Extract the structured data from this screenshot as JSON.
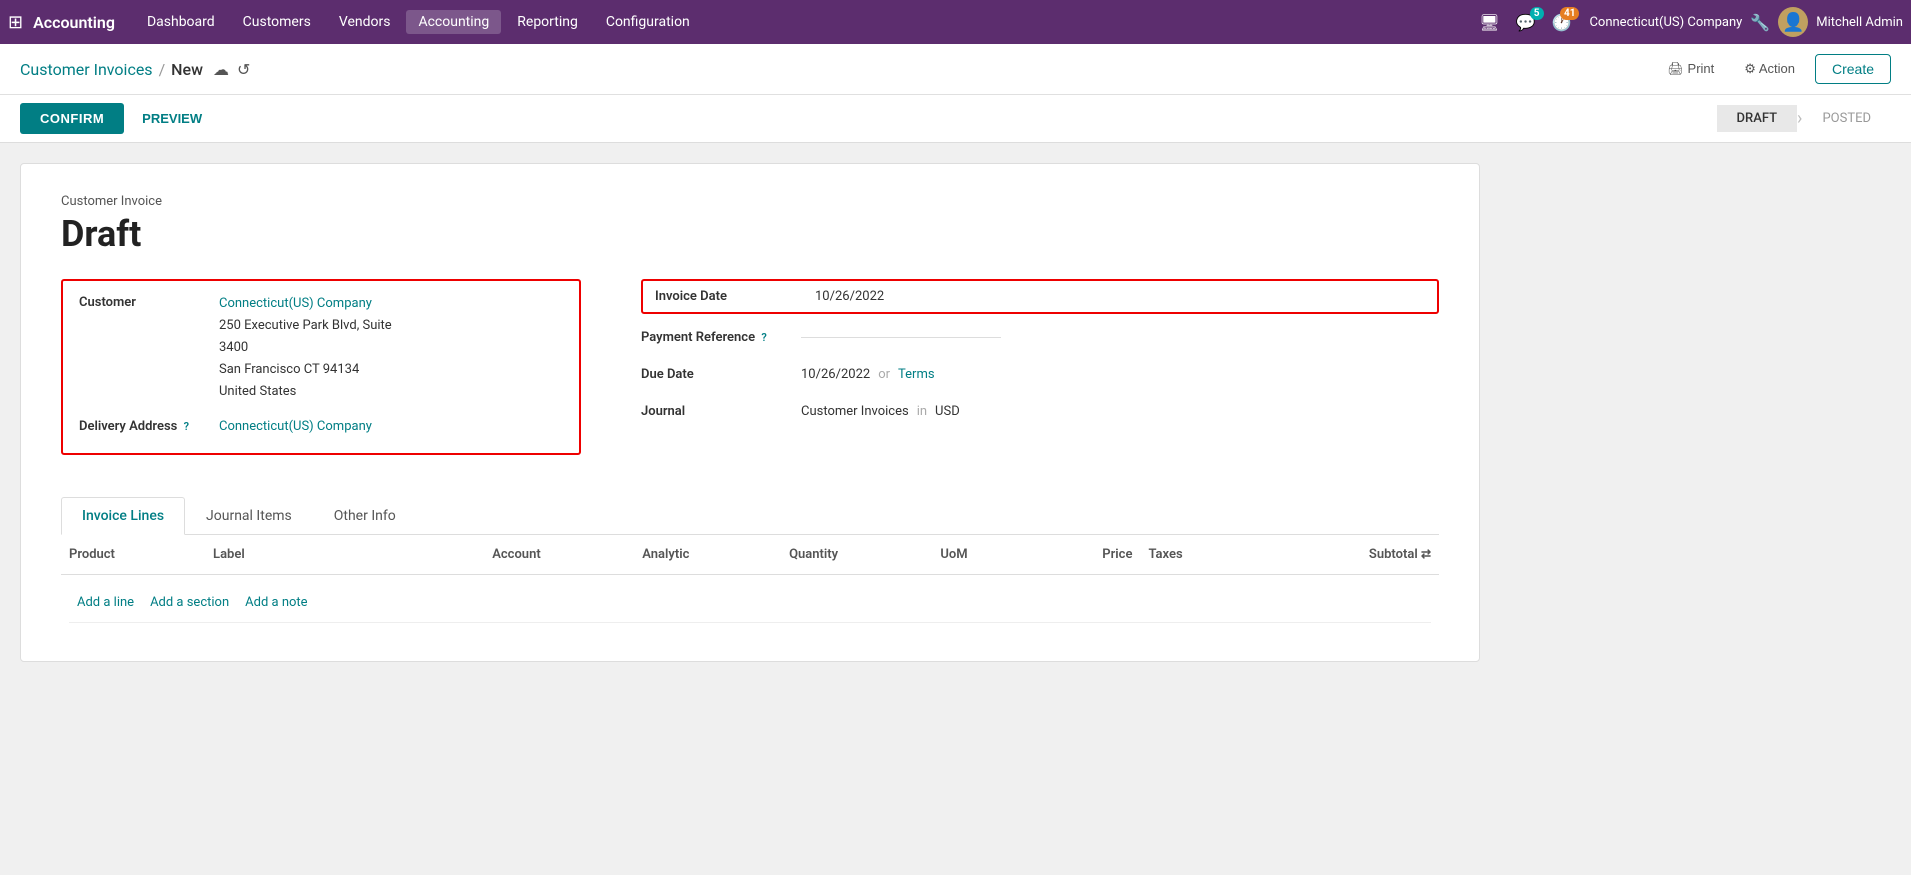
{
  "topnav": {
    "app_name": "Accounting",
    "nav_links": [
      {
        "label": "Dashboard",
        "active": false
      },
      {
        "label": "Customers",
        "active": false
      },
      {
        "label": "Vendors",
        "active": false
      },
      {
        "label": "Accounting",
        "active": true
      },
      {
        "label": "Reporting",
        "active": false
      },
      {
        "label": "Configuration",
        "active": false
      }
    ],
    "notifications_badge": "5",
    "activity_badge": "41",
    "company": "Connecticut(US) Company",
    "user": "Mitchell Admin"
  },
  "header": {
    "breadcrumb_root": "Customer Invoices",
    "breadcrumb_sep": "/",
    "breadcrumb_current": "New",
    "print_label": "Print",
    "action_label": "Action",
    "create_label": "Create"
  },
  "actionbar": {
    "confirm_label": "CONFIRM",
    "preview_label": "PREVIEW",
    "status_draft": "DRAFT",
    "status_posted": "POSTED"
  },
  "invoice": {
    "sub_label": "Customer Invoice",
    "title": "Draft",
    "customer_label": "Customer",
    "customer_name": "Connecticut(US) Company",
    "customer_address_line1": "250 Executive Park Blvd, Suite",
    "customer_address_line2": "3400",
    "customer_address_line3": "San Francisco CT 94134",
    "customer_address_line4": "United States",
    "delivery_label": "Delivery Address",
    "delivery_value": "Connecticut(US) Company",
    "invoice_date_label": "Invoice Date",
    "invoice_date_value": "10/26/2022",
    "payment_ref_label": "Payment Reference",
    "due_date_label": "Due Date",
    "due_date_value": "10/26/2022",
    "or_text": "or",
    "terms_placeholder": "Terms",
    "journal_label": "Journal",
    "journal_value": "Customer Invoices",
    "in_text": "in",
    "currency": "USD"
  },
  "tabs": [
    {
      "label": "Invoice Lines",
      "active": true
    },
    {
      "label": "Journal Items",
      "active": false
    },
    {
      "label": "Other Info",
      "active": false
    }
  ],
  "table": {
    "columns": [
      "Product",
      "Label",
      "Account",
      "Analytic",
      "Quantity",
      "UoM",
      "Price",
      "Taxes",
      "Subtotal"
    ],
    "add_line": "Add a line",
    "add_section": "Add a section",
    "add_note": "Add a note"
  }
}
